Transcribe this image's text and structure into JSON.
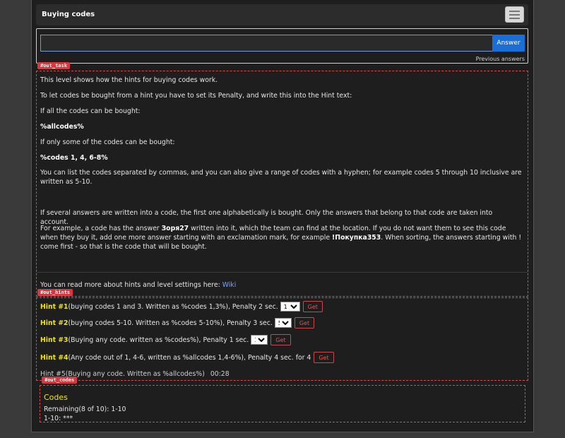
{
  "header": {
    "title": "Buying codes"
  },
  "answer": {
    "placeholder": "",
    "value": "",
    "button_label": "Answer",
    "previous_label": "Previous answers"
  },
  "tags": {
    "task": "#out_task",
    "hints": "#out_hints",
    "codes": "#out_codes"
  },
  "task": {
    "p1": "This level shows how the hints for buying codes work.",
    "p2": "To let codes be bought from a hint you have to set its Penalty, and write this into the Hint text:",
    "p3": "If all the codes can be bought:",
    "p4": "%allcodes%",
    "p5": "If only some of the codes can be bought:",
    "p6": "%codes 1, 4, 6-8%",
    "p7": "You can list the codes separated by commas, and you can also give a range of codes with a hyphen; for example codes 5 through 10 inclusive are written as 5-10.",
    "p8": "If several answers are written into a code, the first one alphabetically is bought. Only the answers that belong to that code are taken into account.",
    "p9a": "For example, a code has the answer ",
    "p9b": "Зоря27",
    "p9c": " written into it, which the team can find at the location. If you do not want them to see this code when they buy it, add one more answer starting with an exclamation mark, for example ",
    "p9d": "!Покупка353",
    "p9e": ". When sorting, the answers starting with ! come first - so that is the code that will be bought.",
    "p10a": "You can read more about hints and level settings here: ",
    "p10link": "Wiki"
  },
  "hints": [
    {
      "num": "Hint #1",
      "text": "(buying codes 1 and 3. Written as %codes 1,3%), Penalty 2 sec.",
      "select": "1",
      "get": "Get"
    },
    {
      "num": "Hint #2",
      "text": "(buying codes 5-10. Written as %codes 5-10%), Penalty 3 sec.",
      "select": "5",
      "get": "Get"
    },
    {
      "num": "Hint #3",
      "text": "(Buying any code. written as %codes%), Penalty 1 sec.",
      "select": "1",
      "get": "Get"
    },
    {
      "num": "Hint #4",
      "text": "(Any code out of 1, 4-6, written as %allcodes 1,4-6%), Penalty 4 sec. for 4",
      "get": "Get"
    }
  ],
  "hint5": {
    "text": "Hint #5(Buying any code. Written as %allcodes%)",
    "timer": "00:28"
  },
  "codes": {
    "title": "Codes",
    "remaining": "Remaining(8 of 10): 1-10",
    "line": "1-10: ***"
  }
}
